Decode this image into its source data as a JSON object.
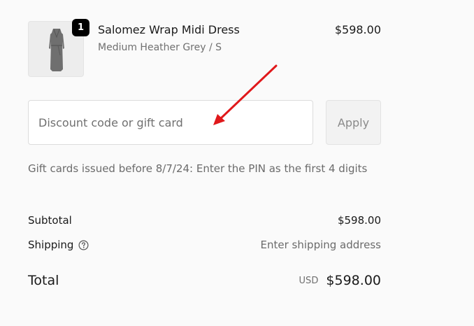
{
  "line_item": {
    "quantity": "1",
    "title": "Salomez Wrap Midi Dress",
    "variant": "Medium Heather Grey / S",
    "price": "$598.00",
    "image_icon": "dress-thumbnail"
  },
  "discount": {
    "placeholder": "Discount code or gift card",
    "value": "",
    "apply_label": "Apply"
  },
  "gift_note": "Gift cards issued before 8/7/24: Enter the PIN as the first 4 digits",
  "summary": {
    "subtotal_label": "Subtotal",
    "subtotal_value": "$598.00",
    "shipping_label": "Shipping",
    "shipping_help_icon": "question-circle-icon",
    "shipping_value": "Enter shipping address"
  },
  "total": {
    "label": "Total",
    "currency": "USD",
    "value": "$598.00"
  },
  "colors": {
    "annotation_arrow": "#e0181b",
    "badge": "#000000"
  }
}
